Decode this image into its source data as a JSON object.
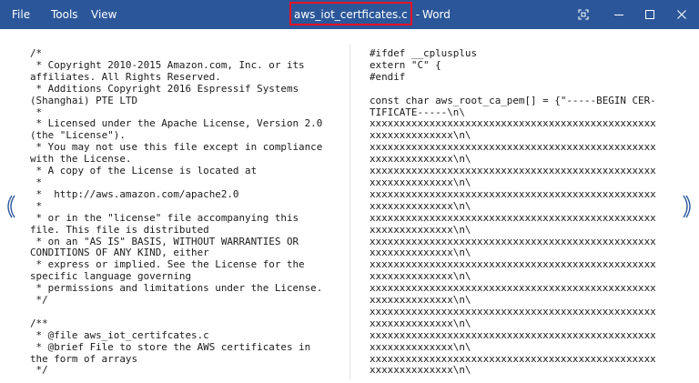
{
  "app": {
    "name": "Word",
    "document_title": "aws_iot_certficates.c",
    "title_separator": "-",
    "accent_color": "#2b579a",
    "highlight_color": "#e81123"
  },
  "menu": {
    "file": "File",
    "tools": "Tools",
    "view": "View"
  },
  "window_controls": {
    "fit_icon": "fit-page-icon",
    "minimize_icon": "minimize-icon",
    "maximize_icon": "maximize-icon",
    "close_icon": "close-icon"
  },
  "navigation": {
    "previous_icon": "chevron-left-icon",
    "next_icon": "chevron-right-icon"
  },
  "document": {
    "left_page": "/*\n * Copyright 2010-2015 Amazon.com, Inc. or its\naffiliates. All Rights Reserved.\n * Additions Copyright 2016 Espressif Systems\n(Shanghai) PTE LTD\n *\n * Licensed under the Apache License, Version 2.0\n(the \"License\").\n * You may not use this file except in compliance\nwith the License.\n * A copy of the License is located at\n *\n *  http://aws.amazon.com/apache2.0\n *\n * or in the \"license\" file accompanying this\nfile. This file is distributed\n * on an \"AS IS\" BASIS, WITHOUT WARRANTIES OR\nCONDITIONS OF ANY KIND, either\n * express or implied. See the License for the\nspecific language governing\n * permissions and limitations under the License.\n */\n\n/**\n * @file aws_iot_certifcates.c\n * @brief File to store the AWS certificates in\nthe form of arrays\n */",
    "right_page": "#ifdef __cplusplus\nextern \"C\" {\n#endif\n\nconst char aws_root_ca_pem[] = {\"-----BEGIN CER-\nTIFICATE-----\\n\\\nxxxxxxxxxxxxxxxxxxxxxxxxxxxxxxxxxxxxxxxxxxxxxxxx\nxxxxxxxxxxxxxx\\n\\\nxxxxxxxxxxxxxxxxxxxxxxxxxxxxxxxxxxxxxxxxxxxxxxxx\nxxxxxxxxxxxxxx\\n\\\nxxxxxxxxxxxxxxxxxxxxxxxxxxxxxxxxxxxxxxxxxxxxxxxx\nxxxxxxxxxxxxxx\\n\\\nxxxxxxxxxxxxxxxxxxxxxxxxxxxxxxxxxxxxxxxxxxxxxxxx\nxxxxxxxxxxxxxx\\n\\\nxxxxxxxxxxxxxxxxxxxxxxxxxxxxxxxxxxxxxxxxxxxxxxxx\nxxxxxxxxxxxxxx\\n\\\nxxxxxxxxxxxxxxxxxxxxxxxxxxxxxxxxxxxxxxxxxxxxxxxx\nxxxxxxxxxxxxxx\\n\\\nxxxxxxxxxxxxxxxxxxxxxxxxxxxxxxxxxxxxxxxxxxxxxxxx\nxxxxxxxxxxxxxx\\n\\\nxxxxxxxxxxxxxxxxxxxxxxxxxxxxxxxxxxxxxxxxxxxxxxxx\nxxxxxxxxxxxxxx\\n\\\nxxxxxxxxxxxxxxxxxxxxxxxxxxxxxxxxxxxxxxxxxxxxxxxx\nxxxxxxxxxxxxxx\\n\\\nxxxxxxxxxxxxxxxxxxxxxxxxxxxxxxxxxxxxxxxxxxxxxxxx\nxxxxxxxxxxxxxx\\n\\\nxxxxxxxxxxxxxxxxxxxxxxxxxxxxxxxxxxxxxxxxxxxxxxxx\nxxxxxxxxxxxxxx\\n\\"
  }
}
